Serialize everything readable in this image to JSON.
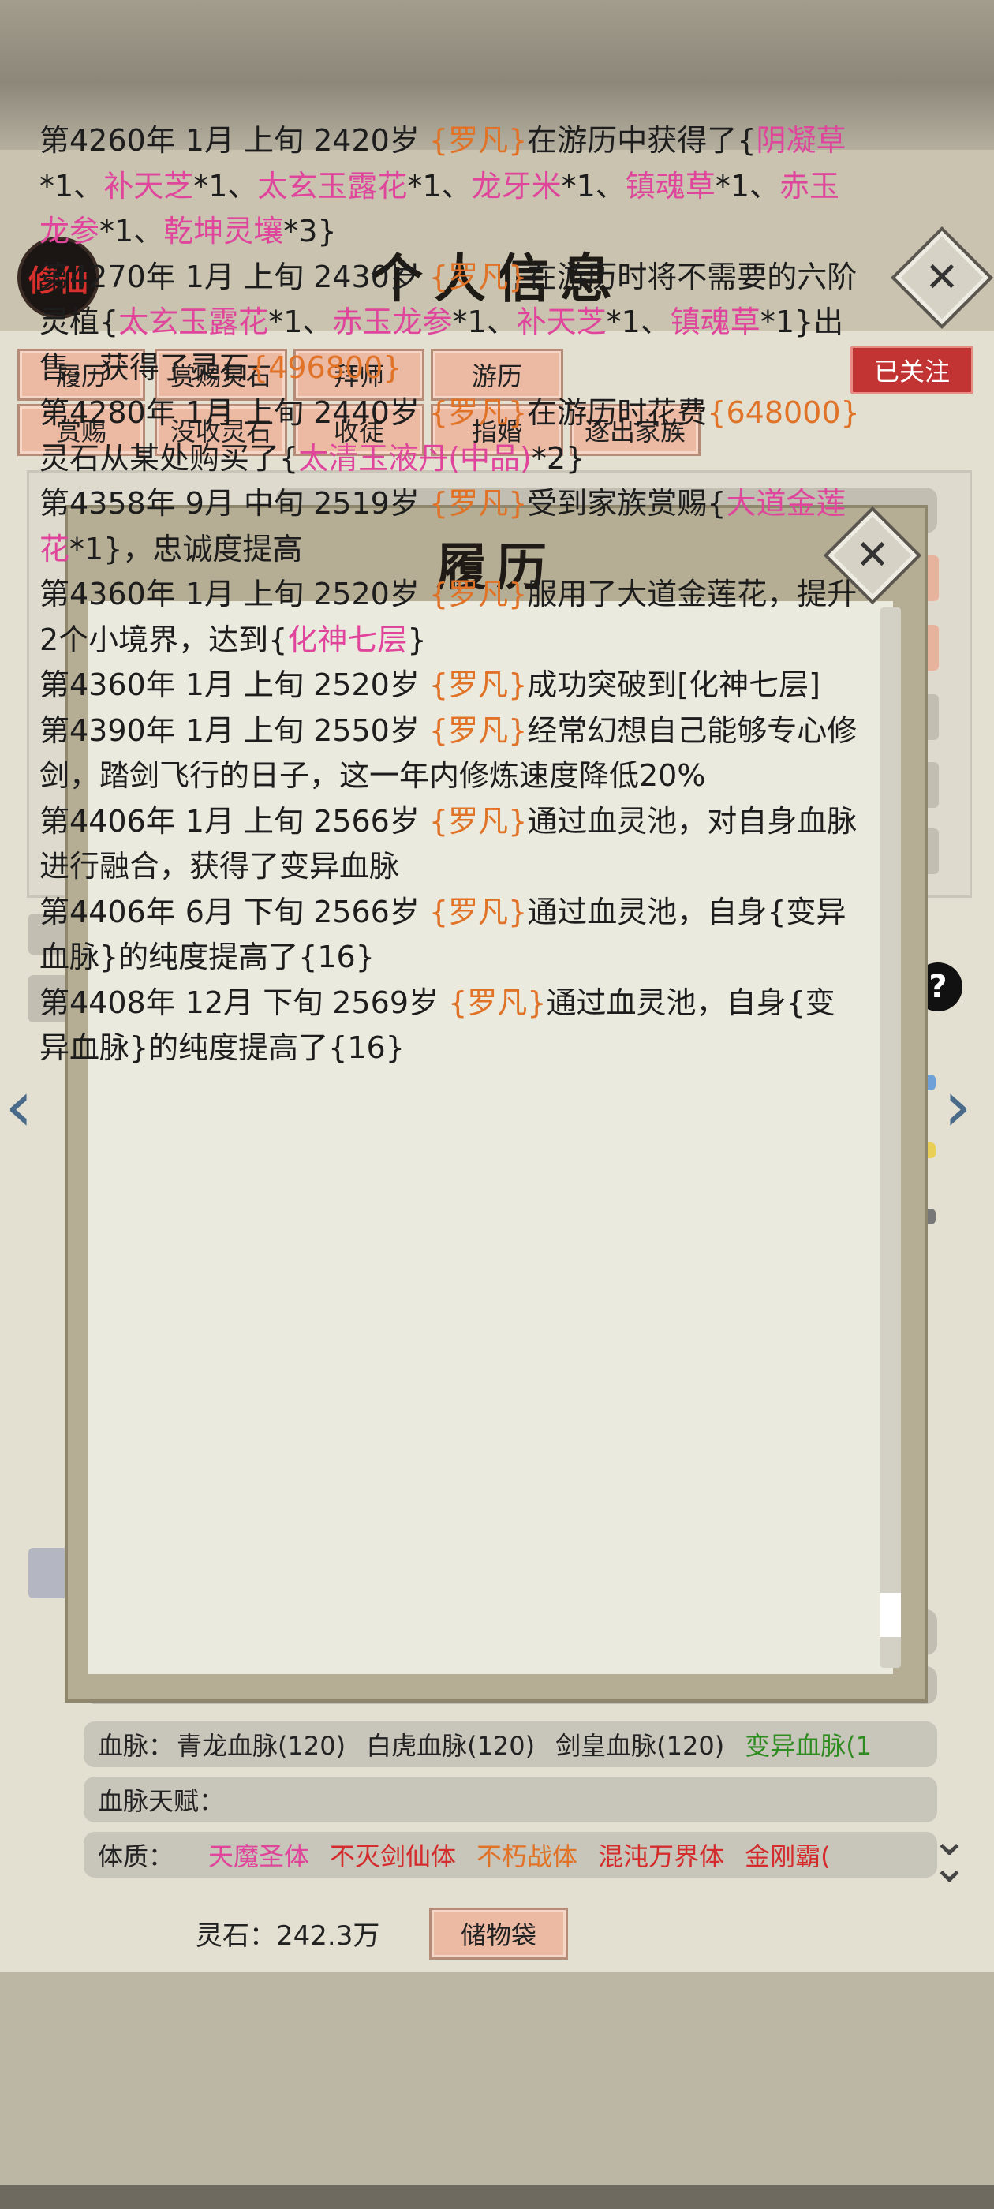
{
  "app": {
    "logo": "修仙",
    "title": "个人信息"
  },
  "action_rows": [
    [
      "履历",
      "赏赐灵石",
      "拜师",
      "游历"
    ],
    [
      "赏赐",
      "没收灵石",
      "收徒",
      "指婚",
      "逐出家族"
    ]
  ],
  "follow_label": "已关注",
  "info_rows": {
    "bloodline": {
      "label": "血脉：",
      "items": [
        {
          "text": "青龙血脉(120)",
          "color": "#222222"
        },
        {
          "text": "白虎血脉(120)",
          "color": "#222222"
        },
        {
          "text": "剑皇血脉(120)",
          "color": "#222222"
        },
        {
          "text": "变异血脉(1",
          "color": "#2e8b1f"
        }
      ]
    },
    "bloodline_talent": {
      "label": "血脉天赋："
    },
    "physique": {
      "label": "体质：",
      "items": [
        {
          "text": "天魔圣体",
          "color": "#e0459c"
        },
        {
          "text": "不灭剑仙体",
          "color": "#d42c2c"
        },
        {
          "text": "不朽战体",
          "color": "#e07328"
        },
        {
          "text": "混沌万界体",
          "color": "#d42c2c"
        },
        {
          "text": "金刚霸(",
          "color": "#d42c2c"
        }
      ]
    }
  },
  "footer": {
    "spirit_stone": "灵石：242.3万",
    "storage_button": "储物袋"
  },
  "modal": {
    "title": "履历",
    "scroll_position": 0.97,
    "entries": [
      [
        {
          "t": "第4260年 1月 上旬  2420岁 ",
          "c": ""
        },
        {
          "t": "{罗凡}",
          "c": "n"
        },
        {
          "t": "在游历中获得了{",
          "c": ""
        },
        {
          "t": "阴凝草",
          "c": "i"
        },
        {
          "t": "*1、",
          "c": ""
        },
        {
          "t": "补天芝",
          "c": "i"
        },
        {
          "t": "*1、",
          "c": ""
        },
        {
          "t": "太玄玉露花",
          "c": "i"
        },
        {
          "t": "*1、",
          "c": ""
        },
        {
          "t": "龙牙米",
          "c": "i"
        },
        {
          "t": "*1、",
          "c": ""
        },
        {
          "t": "镇魂草",
          "c": "i"
        },
        {
          "t": "*1、",
          "c": ""
        },
        {
          "t": "赤玉龙参",
          "c": "i"
        },
        {
          "t": "*1、",
          "c": ""
        },
        {
          "t": "乾坤灵壤",
          "c": "i"
        },
        {
          "t": "*3}",
          "c": ""
        }
      ],
      [
        {
          "t": "第4270年 1月 上旬  2430岁 ",
          "c": ""
        },
        {
          "t": "{罗凡}",
          "c": "n"
        },
        {
          "t": "在游历时将不需要的六阶灵植{",
          "c": ""
        },
        {
          "t": "太玄玉露花",
          "c": "i"
        },
        {
          "t": "*1、",
          "c": ""
        },
        {
          "t": "赤玉龙参",
          "c": "i"
        },
        {
          "t": "*1、",
          "c": ""
        },
        {
          "t": "补天芝",
          "c": "i"
        },
        {
          "t": "*1、",
          "c": ""
        },
        {
          "t": "镇魂草",
          "c": "i"
        },
        {
          "t": "*1}出售，获得了灵石",
          "c": ""
        },
        {
          "t": "{496800}",
          "c": "g"
        }
      ],
      [
        {
          "t": "第4280年  1月  上旬   2440岁   ",
          "c": ""
        },
        {
          "t": "{罗凡}",
          "c": "n"
        },
        {
          "t": "在游历时花费",
          "c": ""
        },
        {
          "t": "{648000}",
          "c": "g"
        },
        {
          "t": "灵石从某处购买了{",
          "c": ""
        },
        {
          "t": "太清玉液丹(中品)",
          "c": "i"
        },
        {
          "t": "*2}",
          "c": ""
        }
      ],
      [
        {
          "t": "第4358年 9月 中旬  2519岁 ",
          "c": ""
        },
        {
          "t": "{罗凡}",
          "c": "n"
        },
        {
          "t": "受到家族赏赐{",
          "c": ""
        },
        {
          "t": "大道金莲花",
          "c": "i"
        },
        {
          "t": "*1}，忠诚度提高",
          "c": ""
        }
      ],
      [
        {
          "t": "第4360年 1月 上旬  2520岁 ",
          "c": ""
        },
        {
          "t": "{罗凡}",
          "c": "n"
        },
        {
          "t": "服用了大道金莲花，提升2个小境界，达到{",
          "c": ""
        },
        {
          "t": "化神七层",
          "c": "i"
        },
        {
          "t": "}",
          "c": ""
        }
      ],
      [
        {
          "t": "第4360年 1月 上旬  2520岁 ",
          "c": ""
        },
        {
          "t": "{罗凡}",
          "c": "n"
        },
        {
          "t": "成功突破到[化神七层]",
          "c": ""
        }
      ],
      [
        {
          "t": "第4390年 1月 上旬  2550岁 ",
          "c": ""
        },
        {
          "t": "{罗凡}",
          "c": "n"
        },
        {
          "t": "经常幻想自己能够专心修剑，踏剑飞行的日子，这一年内修炼速度降低20%",
          "c": ""
        }
      ],
      [
        {
          "t": "第4406年 1月 上旬  2566岁 ",
          "c": ""
        },
        {
          "t": "{罗凡}",
          "c": "n"
        },
        {
          "t": "通过血灵池，对自身血脉进行融合，获得了变异血脉",
          "c": ""
        }
      ],
      [
        {
          "t": "第4406年 6月  下旬   2566岁   ",
          "c": ""
        },
        {
          "t": "{罗凡}",
          "c": "n"
        },
        {
          "t": "通过血灵池，自身{变异血脉}的纯度提高了{16}",
          "c": ""
        }
      ],
      [
        {
          "t": "第4408年 12月  下旬  2569岁  ",
          "c": ""
        },
        {
          "t": "{罗凡}",
          "c": "n"
        },
        {
          "t": "通过血灵池，自身{变异血脉}的纯度提高了{16}",
          "c": ""
        }
      ]
    ]
  }
}
